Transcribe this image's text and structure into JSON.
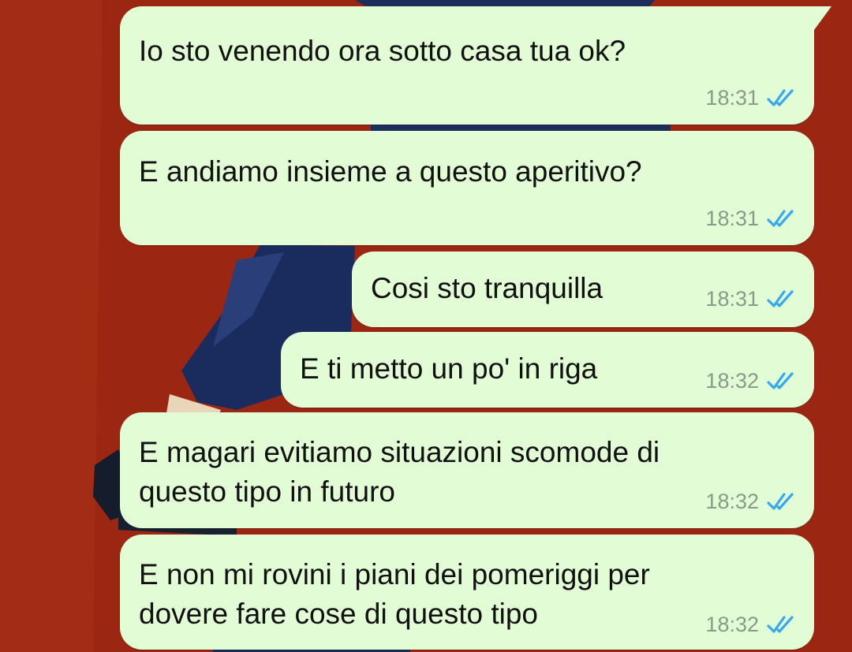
{
  "chat": {
    "messages": [
      {
        "text": "Io sto venendo ora sotto casa tua ok?",
        "time": "18:31",
        "status": "read-double-check-icon"
      },
      {
        "text": "E andiamo insieme a questo aperitivo?",
        "time": "18:31",
        "status": "read-double-check-icon"
      },
      {
        "text": "Cosi sto tranquilla",
        "time": "18:31",
        "status": "read-double-check-icon"
      },
      {
        "text": "E ti metto un po' in riga",
        "time": "18:32",
        "status": "read-double-check-icon"
      },
      {
        "text": "E magari evitiamo situazioni scomode di\nquesto tipo in futuro",
        "time": "18:32",
        "status": "read-double-check-icon"
      },
      {
        "text": "E non mi rovini i piani dei pomeriggi per\ndovere fare cose di questo tipo",
        "time": "18:32",
        "status": "read-double-check-icon"
      }
    ]
  },
  "colors": {
    "wallpaper": "#9b2712",
    "bubble_outgoing": "#e2fdd5",
    "read_ticks": "#35a9ef",
    "time_text": "#8a9a88"
  }
}
